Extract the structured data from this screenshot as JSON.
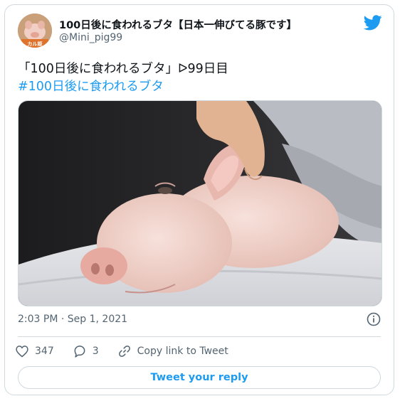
{
  "tweet": {
    "author_name": "100日後に食われるブタ【日本一伸びてる豚です】",
    "author_handle": "@Mini_pig99",
    "avatar_label": "カル姫",
    "text_line1": "「100日後に食われるブタ」ᐅ99日目",
    "hashtag": "#100日後に食われるブタ",
    "timestamp": "2:03 PM · Sep 1, 2021",
    "likes": "347",
    "replies": "3",
    "copy_link_label": "Copy link to Tweet",
    "reply_button_label": "Tweet your reply"
  },
  "icons": {
    "brand": "twitter-bird-icon",
    "info": "info-icon",
    "like": "heart-icon",
    "reply": "reply-icon",
    "link": "link-icon"
  },
  "colors": {
    "accent": "#1d9bf0",
    "secondary_text": "#536471",
    "border": "#cfd9de"
  }
}
